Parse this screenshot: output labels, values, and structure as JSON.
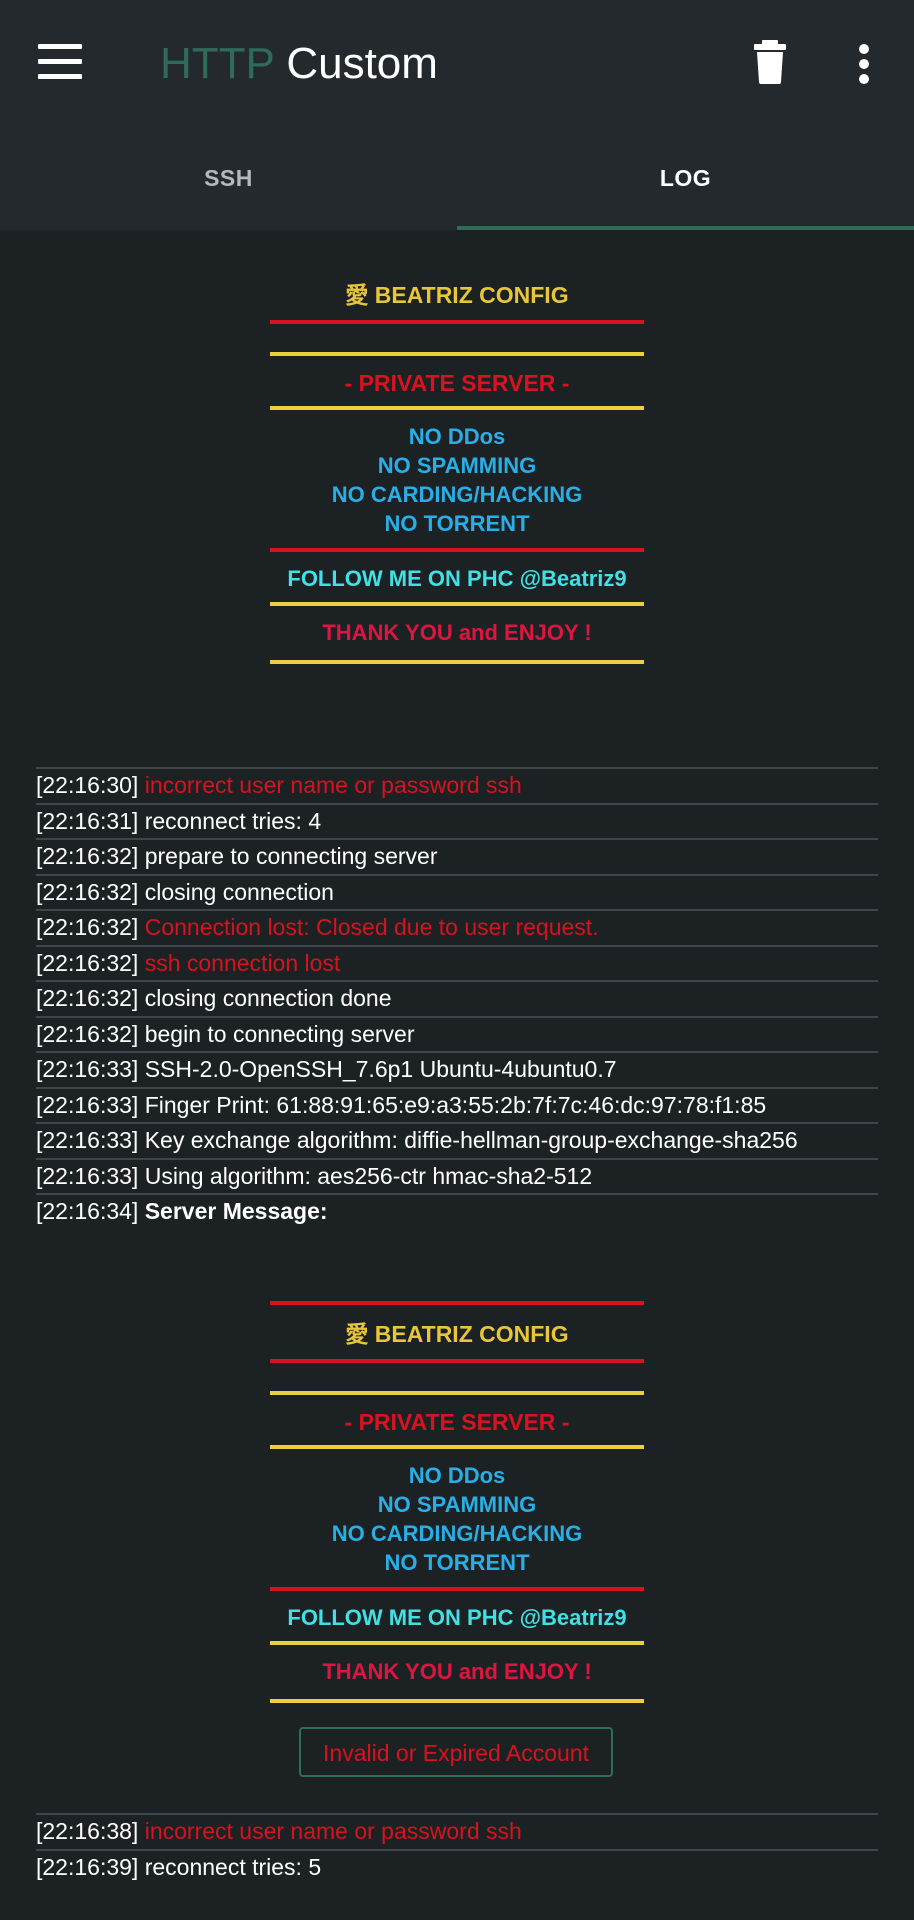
{
  "appbar": {
    "title_part1": "HTTP",
    "title_part2": "Custom",
    "menu_icon": "hamburger-menu-icon",
    "delete_icon": "trash-icon",
    "more_icon": "more-vert-icon"
  },
  "tabs": [
    {
      "label": "SSH",
      "active": false
    },
    {
      "label": "LOG",
      "active": true
    }
  ],
  "banner": {
    "title": "愛 BEATRIZ CONFIG",
    "private": "- PRIVATE SERVER -",
    "rules": [
      "NO DDos",
      "NO SPAMMING",
      "NO CARDING/HACKING",
      "NO TORRENT"
    ],
    "follow": "FOLLOW ME ON PHC @Beatriz9",
    "thanks": "THANK YOU and ENJOY !"
  },
  "log": [
    {
      "time": "[22:16:30]",
      "message": "incorrect user name or password ssh",
      "style": "red"
    },
    {
      "time": "[22:16:31]",
      "message": "reconnect tries: 4",
      "style": "normal"
    },
    {
      "time": "[22:16:32]",
      "message": "prepare to connecting server",
      "style": "normal"
    },
    {
      "time": "[22:16:32]",
      "message": "closing connection",
      "style": "normal"
    },
    {
      "time": "[22:16:32]",
      "message": "Connection lost: Closed due to user request.",
      "style": "red"
    },
    {
      "time": "[22:16:32]",
      "message": "ssh connection lost",
      "style": "red"
    },
    {
      "time": "[22:16:32]",
      "message": "closing connection done",
      "style": "normal"
    },
    {
      "time": "[22:16:32]",
      "message": "begin to connecting server",
      "style": "normal"
    },
    {
      "time": "[22:16:33]",
      "message": "SSH-2.0-OpenSSH_7.6p1 Ubuntu-4ubuntu0.7",
      "style": "normal"
    },
    {
      "time": "[22:16:33]",
      "message": "Finger Print: 61:88:91:65:e9:a3:55:2b:7f:7c:46:dc:97:78:f1:85",
      "style": "normal"
    },
    {
      "time": "[22:16:33]",
      "message": "Key exchange algorithm: diffie-hellman-group-exchange-sha256",
      "style": "normal"
    },
    {
      "time": "[22:16:33]",
      "message": "Using algorithm: aes256-ctr hmac-sha2-512",
      "style": "normal"
    },
    {
      "time": "[22:16:34]",
      "message": "Server Message:",
      "style": "bold"
    }
  ],
  "log2": [
    {
      "time": "[22:16:38]",
      "message": "incorrect user name or password ssh",
      "style": "red"
    },
    {
      "time": "[22:16:39]",
      "message": "reconnect tries: 5",
      "style": "normal"
    }
  ],
  "toast": "Invalid or Expired Account",
  "colors": {
    "background": "#1c2124",
    "toolbar": "#23292d",
    "accent_green": "#2e6b58",
    "error_red": "#d8121e",
    "banner_yellow": "#e8c63a",
    "banner_blue": "#2aaee6",
    "banner_cyan": "#41e0e4"
  }
}
